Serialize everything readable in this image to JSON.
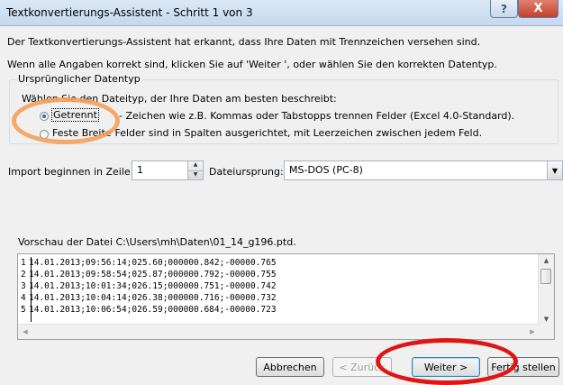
{
  "window": {
    "title": "Textkonvertierungs-Assistent - Schritt 1 von 3",
    "help_label": "?",
    "close_label": "X"
  },
  "intro": {
    "line1": "Der Textkonvertierungs-Assistent hat erkannt, dass Ihre Daten mit Trennzeichen versehen sind.",
    "line2": "Wenn alle Angaben korrekt sind, klicken Sie auf 'Weiter ', oder wählen Sie den korrekten Datentyp."
  },
  "original_type": {
    "legend": "Ursprünglicher Datentyp",
    "prompt": "Wählen Sie den Dateityp, der Ihre Daten am besten beschreibt:",
    "options": [
      {
        "label": "Getrennt",
        "description": "- Zeichen wie z.B. Kommas oder Tabstopps trennen Felder (Excel 4.0-Standard).",
        "selected": true
      },
      {
        "label": "Feste Breite",
        "description": "- Felder sind in Spalten ausgerichtet, mit Leerzeichen zwischen jedem Feld.",
        "selected": false
      }
    ]
  },
  "import_start": {
    "label": "Import beginnen in Zeile:",
    "value": "1"
  },
  "file_origin": {
    "label": "Dateiursprung:",
    "value": "MS-DOS (PC-8)"
  },
  "preview": {
    "label": "Vorschau der Datei C:\\Users\\mh\\Daten\\01_14_g196.ptd.",
    "rows": [
      {
        "num": "1",
        "text": "14.01.2013;09:56:14;025.60;000000.842;-00000.765"
      },
      {
        "num": "2",
        "text": "14.01.2013;09:58:54;025.87;000000.792;-00000.755"
      },
      {
        "num": "3",
        "text": "14.01.2013;10:01:34;026.15;000000.751;-00000.742"
      },
      {
        "num": "4",
        "text": "14.01.2013;10:04:14;026.38;000000.716;-00000.732"
      },
      {
        "num": "5",
        "text": "14.01.2013;10:06:54;026.59;000000.684;-00000.723"
      }
    ]
  },
  "buttons": {
    "cancel": "Abbrechen",
    "back": "< Zurück",
    "next": "Weiter >",
    "finish": "Fertig stellen"
  },
  "colors": {
    "annotation_orange": "#f5a05a",
    "annotation_red": "#e01616"
  }
}
